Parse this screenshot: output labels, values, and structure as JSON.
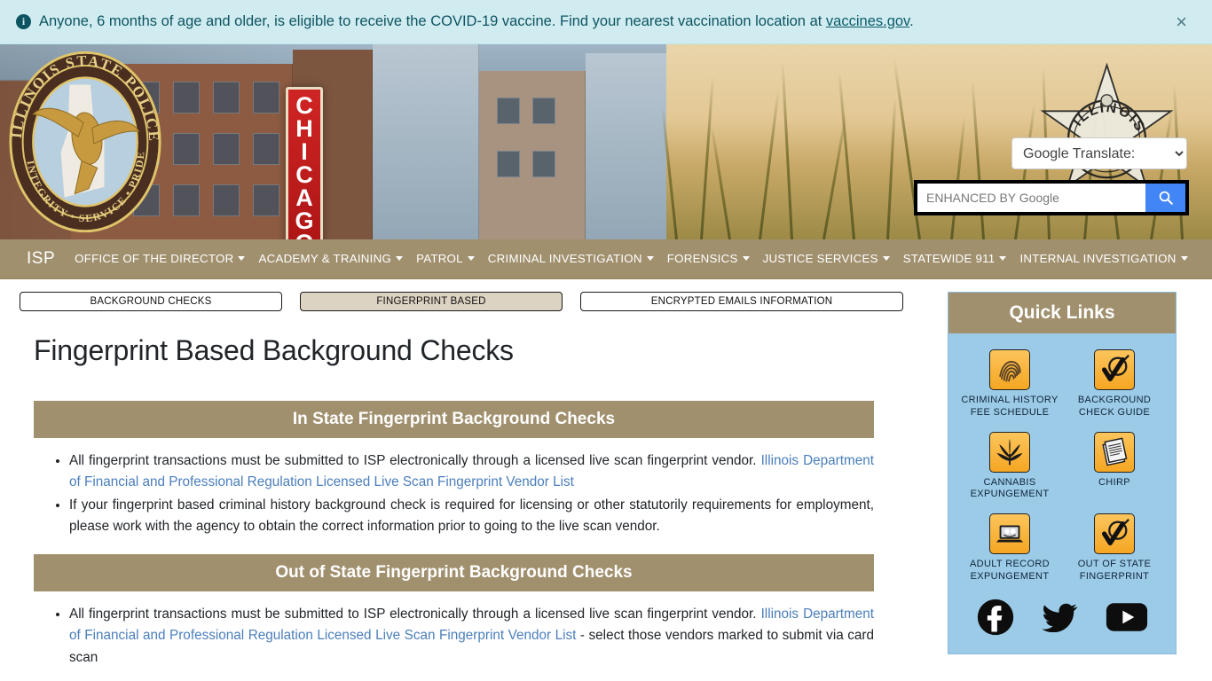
{
  "alert": {
    "icon": "info-icon",
    "text_before": "Anyone, 6 months of age and older, is eligible to receive the COVID-19 vaccine. Find your nearest vaccination location at ",
    "link_text": "vaccines.gov",
    "text_after": ".",
    "close_label": "×",
    "bg_color": "#d1ecf1",
    "text_color": "#0c5460"
  },
  "hero": {
    "seal_text": "ILLINOIS STATE POLICE • INTEGRITY • SERVICE • PRIDE",
    "sign_text": "CHICAGO",
    "badge_text": "ILLINOIS TROOPER",
    "translate": {
      "label": "Google Translate:",
      "options": [
        "Google Translate:"
      ]
    },
    "search": {
      "placeholder": "ENHANCED BY Google",
      "value": "",
      "button_icon": "search-icon",
      "button_color": "#4285f4"
    }
  },
  "nav": {
    "brand": "ISP",
    "bg_color": "#a1906e",
    "items": [
      {
        "label": "OFFICE OF THE DIRECTOR",
        "has_caret": true
      },
      {
        "label": "ACADEMY & TRAINING",
        "has_caret": true
      },
      {
        "label": "PATROL",
        "has_caret": true
      },
      {
        "label": "CRIMINAL INVESTIGATION",
        "has_caret": true
      },
      {
        "label": "FORENSICS",
        "has_caret": true
      },
      {
        "label": "JUSTICE SERVICES",
        "has_caret": true
      },
      {
        "label": "STATEWIDE 911",
        "has_caret": true
      },
      {
        "label": "INTERNAL INVESTIGATION",
        "has_caret": true
      }
    ]
  },
  "main": {
    "tabs": [
      {
        "label": "BACKGROUND CHECKS",
        "active": false
      },
      {
        "label": "FINGERPRINT BASED",
        "active": true
      },
      {
        "label": "ENCRYPTED EMAILS INFORMATION",
        "active": false
      }
    ],
    "page_title": "Fingerprint Based Background Checks",
    "sections": [
      {
        "heading": "In State Fingerprint Background Checks",
        "bullets": [
          {
            "pre": "All fingerprint transactions must be submitted to ISP electronically through a licensed live scan fingerprint vendor. ",
            "link": "Illinois Department of Financial and Professional Regulation Licensed Live Scan Fingerprint Vendor List",
            "post": ""
          },
          {
            "pre": "If your fingerprint based criminal history background check is required for licensing or other statutorily requirements for employment, please work with the agency to obtain the correct information prior to going to the live scan vendor.",
            "link": "",
            "post": ""
          }
        ]
      },
      {
        "heading": "Out of State Fingerprint Background Checks",
        "bullets": [
          {
            "pre": "All fingerprint transactions must be submitted to ISP electronically through a licensed live scan fingerprint vendor. ",
            "link": "Illinois Department of Financial and Professional Regulation Licensed Live Scan Fingerprint Vendor List",
            "post": " - select those vendors marked to submit via card scan"
          }
        ]
      }
    ],
    "section_bg": "#a1906e"
  },
  "sidebar": {
    "title": "Quick Links",
    "bg_color": "#9ccbe8",
    "header_color": "#a1906e",
    "links": [
      {
        "label": "CRIMINAL HISTORY FEE SCHEDULE",
        "icon": "fingerprint-icon"
      },
      {
        "label": "BACKGROUND CHECK GUIDE",
        "icon": "magnifier-check-icon"
      },
      {
        "label": "CANNABIS EXPUNGEMENT",
        "icon": "cannabis-leaf-icon"
      },
      {
        "label": "CHIRP",
        "icon": "documents-icon"
      },
      {
        "label": "ADULT RECORD EXPUNGEMENT",
        "icon": "laptop-record-icon"
      },
      {
        "label": "OUT OF STATE FINGERPRINT",
        "icon": "magnifier-check-icon"
      }
    ],
    "social": [
      {
        "name": "facebook-icon"
      },
      {
        "name": "twitter-icon"
      },
      {
        "name": "youtube-icon"
      }
    ]
  }
}
